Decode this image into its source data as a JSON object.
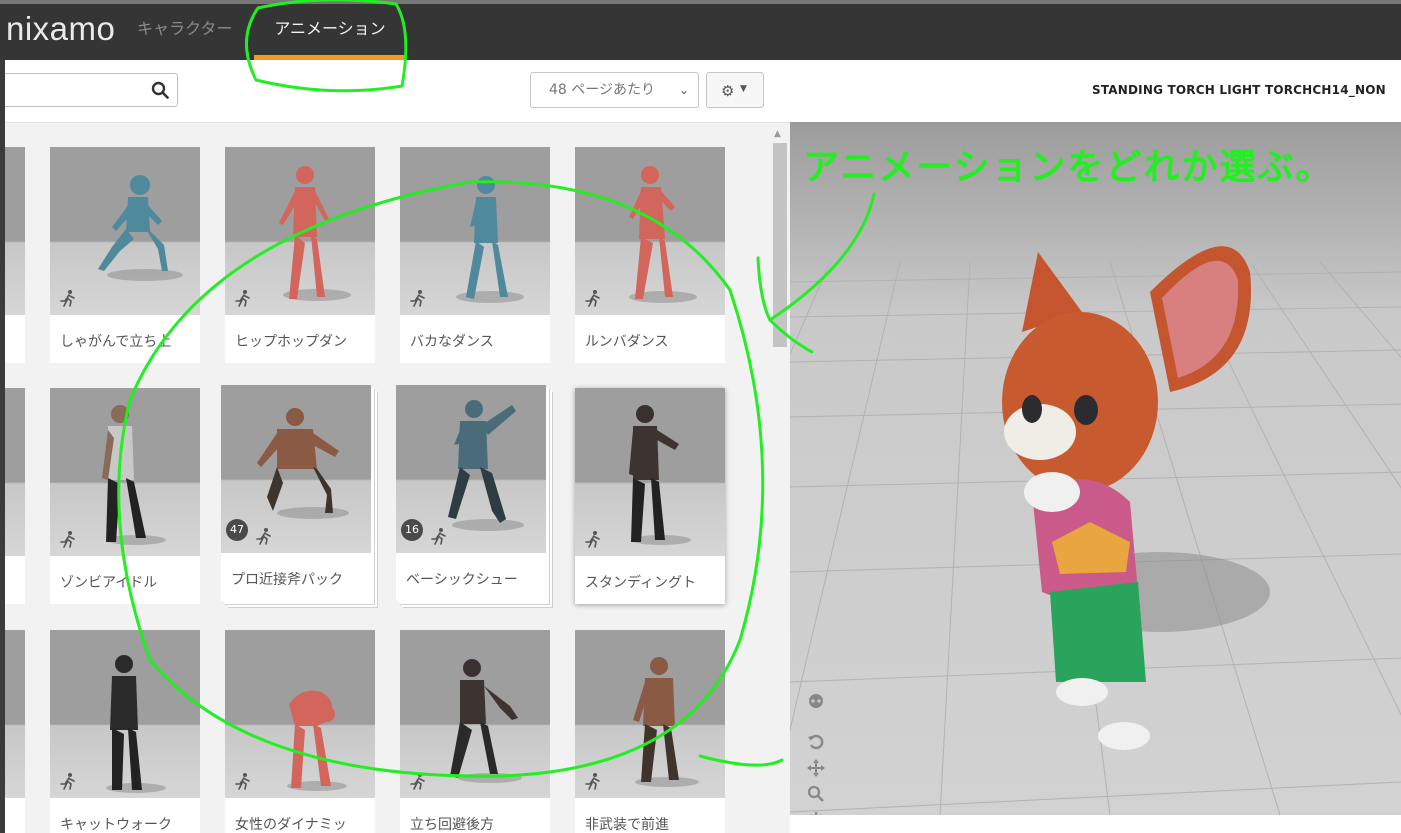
{
  "app": {
    "logo": "nixamo"
  },
  "nav": {
    "tabs": [
      {
        "label": "キャラクター"
      },
      {
        "label": "アニメーション"
      }
    ]
  },
  "toolbar": {
    "per_page_value": "48 ページあたり"
  },
  "animation_cards": [
    {
      "label": "しゃがんで立ち上"
    },
    {
      "label": "ヒップホップダン"
    },
    {
      "label": "バカなダンス"
    },
    {
      "label": "ルンバダンス"
    },
    {
      "label": "ゾンビアイドル"
    },
    {
      "label": "プロ近接斧パック",
      "count": "47"
    },
    {
      "label": "ベーシックシュー",
      "count": "16"
    },
    {
      "label": "スタンディングト"
    },
    {
      "label": "キャットウォーク"
    },
    {
      "label": "女性のダイナミッ"
    },
    {
      "label": "立ち回避後方"
    },
    {
      "label": "非武装で前進"
    }
  ],
  "preview": {
    "title": "STANDING TORCH LIGHT TORCHCH14_NON"
  },
  "annotation": {
    "text": "アニメーションをどれか選ぶ。",
    "color": "#22ee22"
  },
  "colors": {
    "accent": "#f39a24",
    "topbar": "#353535"
  }
}
